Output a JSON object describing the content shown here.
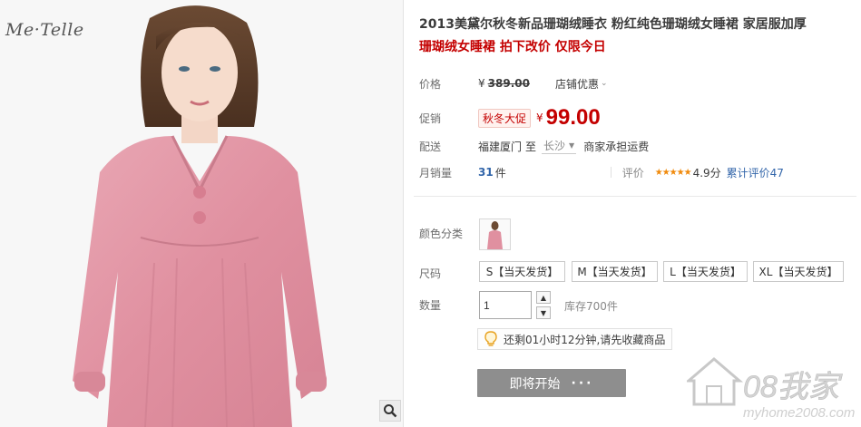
{
  "gallery": {
    "brand_logo": "Me·Telle",
    "zoom_icon": "magnifier-icon"
  },
  "product": {
    "title": "2013美黛尔秋冬新品珊瑚绒睡衣 粉红纯色珊瑚绒女睡裙 家居服加厚",
    "subtitle": "珊瑚绒女睡裙 拍下改价 仅限今日"
  },
  "price": {
    "label": "价格",
    "currency": "¥",
    "original": "389.00",
    "shop_discount": "店铺优惠",
    "promo_label": "促销",
    "promo_tag": "秋冬大促",
    "now": "99.00"
  },
  "shipping": {
    "label": "配送",
    "from": "福建厦门",
    "to_word": "至",
    "city": "长沙",
    "freight": "商家承担运费"
  },
  "sales": {
    "label": "月销量",
    "count": "31",
    "unit": "件",
    "rating_label": "评价",
    "stars": "★★★★★",
    "score": "4.9分",
    "reviews": "累计评价47"
  },
  "options": {
    "color_label": "颜色分类",
    "size_label": "尺码",
    "sizes": [
      "S【当天发货】",
      "M【当天发货】",
      "L【当天发货】",
      "XL【当天发货】"
    ],
    "qty_label": "数量",
    "qty_value": "1",
    "stock": "库存700件"
  },
  "notice": {
    "text": "还剩01小时12分钟,请先收藏商品",
    "icon": "lightbulb-icon"
  },
  "buy": {
    "label": "即将开始",
    "dots": "···"
  },
  "watermark": {
    "brand": "08我家",
    "url": "myhome2008.com"
  },
  "colors": {
    "accent": "#c40000",
    "link": "#3366aa",
    "button_disabled": "#8e8e8e",
    "star": "#f08a0c"
  }
}
